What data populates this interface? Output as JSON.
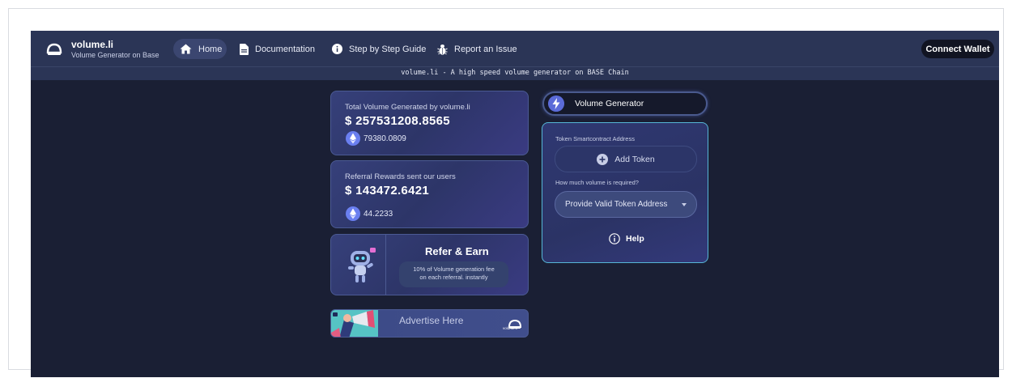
{
  "brand": {
    "name": "volume.li",
    "subtitle": "Volume Generator on Base"
  },
  "nav": {
    "home": "Home",
    "documentation": "Documentation",
    "guide": "Step by Step Guide",
    "report": "Report an Issue"
  },
  "connect_wallet": "Connect Wallet",
  "tagline": "volume.li - A high speed volume generator on BASE Chain",
  "stats": {
    "total_label": "Total Volume Generated by volume.li",
    "total_value": "$ 257531208.8565",
    "total_eth": "79380.0809",
    "referral_label": "Referral Rewards sent our users",
    "referral_value": "$ 143472.6421",
    "referral_eth": "44.2233"
  },
  "refer": {
    "title": "Refer & Earn",
    "desc_line1": "10% of Volume generation fee",
    "desc_line2": "on each referral. instantly"
  },
  "ad": {
    "text": "Advertise Here",
    "logo_text": "volume.li"
  },
  "generator": {
    "tab_label": "Volume Generator",
    "token_label": "Token Smartcontract Address",
    "add_token": "Add Token",
    "volume_label": "How much volume is required?",
    "select_value": "Provide Valid Token Address",
    "help": "Help"
  },
  "colors": {
    "background": "#1a1f34",
    "navbar": "#2b3556",
    "card": "#2d3568",
    "accent_cyan": "#56b6d6",
    "eth_blue": "#6a7ff0"
  },
  "icons": [
    "logo-icon",
    "home-icon",
    "document-icon",
    "info-icon",
    "bug-icon",
    "ethereum-icon",
    "lightning-icon",
    "plus-circle-icon",
    "caret-down-icon",
    "info-circle-icon"
  ]
}
